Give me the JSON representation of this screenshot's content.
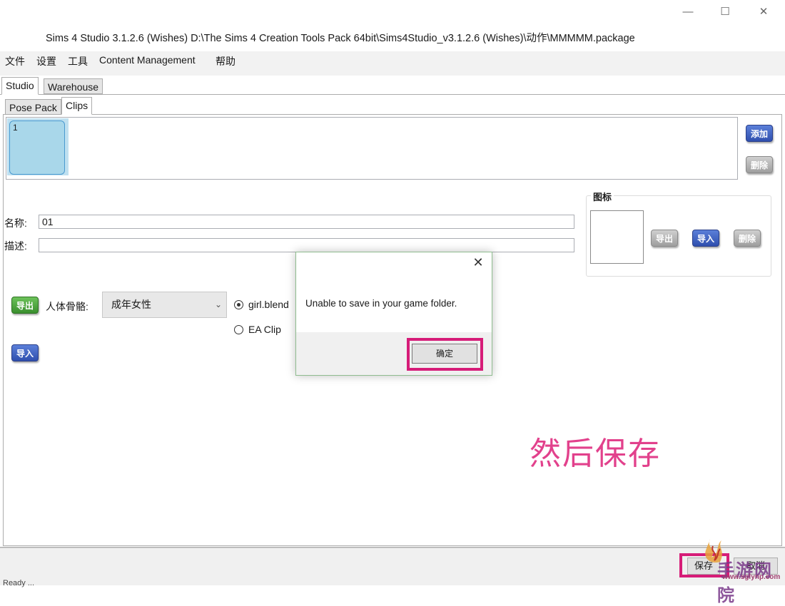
{
  "window": {
    "title": "Sims 4 Studio 3.1.2.6 (Wishes)  D:\\The Sims 4 Creation Tools Pack 64bit\\Sims4Studio_v3.1.2.6 (Wishes)\\动作\\MMMMM.package",
    "minimize_glyph": "—",
    "maximize_glyph": "☐",
    "close_glyph": "✕"
  },
  "menu": [
    "文件",
    "设置",
    "工具",
    "Content Management",
    "帮助"
  ],
  "outer_tabs": [
    {
      "label": "Studio",
      "active": true
    },
    {
      "label": "Warehouse",
      "active": false
    }
  ],
  "inner_tabs": [
    {
      "label": "Pose Pack",
      "active": false
    },
    {
      "label": "Clips",
      "active": true
    }
  ],
  "clips": [
    {
      "label": "1",
      "selected": true
    }
  ],
  "clip_buttons": {
    "add": "添加",
    "delete": "删除"
  },
  "form": {
    "name_label": "名称:",
    "name_value": "01",
    "desc_label": "描述:",
    "desc_value": ""
  },
  "icon_group": {
    "title": "图标",
    "export": "导出",
    "import": "导入",
    "delete": "删除"
  },
  "rig": {
    "export": "导出",
    "label": "人体骨骼:",
    "selected": "成年女性",
    "import": "导入",
    "radio_blend": "girl.blend",
    "radio_clip": "EA Clip"
  },
  "dialog": {
    "message": "Unable to save in your game folder.",
    "ok": "确定",
    "close_glyph": "✕"
  },
  "annotation": "然后保存",
  "bottom": {
    "save": "保存",
    "cancel": "取消",
    "status": "Ready  ..."
  },
  "watermark": {
    "text": "手游网院",
    "url": "www.sglynp.com"
  },
  "colors": {
    "highlight": "#d61c78",
    "annotation": "#e2418c",
    "clip_selected": "#a9d7ea"
  }
}
